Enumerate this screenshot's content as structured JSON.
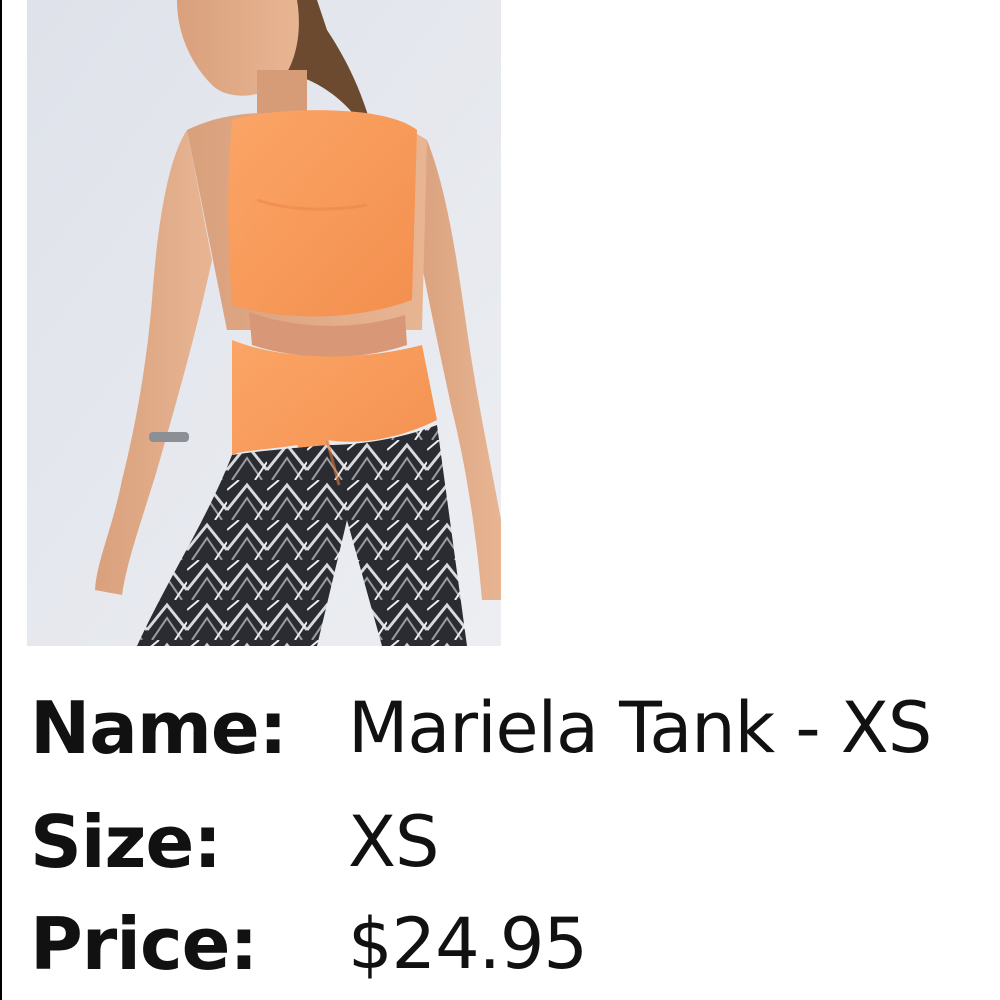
{
  "product": {
    "image_alt": "Model wearing orange open-back tank top with printed leggings",
    "image_background": "#e4e6ec",
    "tank_color": "#f99e5c",
    "details": [
      {
        "label": "Name:",
        "value": "Mariela Tank - XS"
      },
      {
        "label": "Size:",
        "value": "XS"
      },
      {
        "label": "Price:",
        "value": "$24.95"
      }
    ]
  }
}
